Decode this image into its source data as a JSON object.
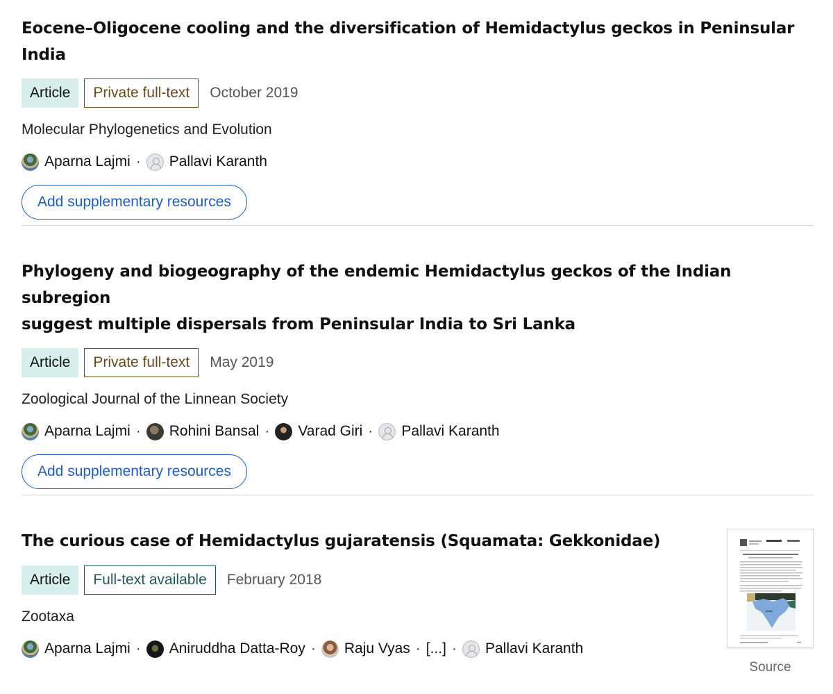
{
  "publications": [
    {
      "title": "Eocene–Oligocene cooling and the diversification of Hemidactylus geckos in Peninsular India",
      "type": "Article",
      "access": "Private full-text",
      "date": "October 2019",
      "journal": "Molecular Phylogenetics and Evolution",
      "authors": [
        "Aparna Lajmi",
        "Pallavi Karanth"
      ],
      "button": "Add supplementary resources"
    },
    {
      "title_line1": "Phylogeny and biogeography of the endemic Hemidactylus geckos of the Indian subregion",
      "title_line2": "suggest multiple dispersals from Peninsular India to Sri Lanka",
      "type": "Article",
      "access": "Private full-text",
      "date": "May 2019",
      "journal": "Zoological Journal of the Linnean Society",
      "authors": [
        "Aparna Lajmi",
        "Rohini Bansal",
        "Varad Giri",
        "Pallavi Karanth"
      ],
      "button": "Add supplementary resources"
    },
    {
      "title": "The curious case of Hemidactylus gujaratensis (Squamata: Gekkonidae)",
      "type": "Article",
      "access": "Full-text available",
      "date": "February 2018",
      "journal": "Zootaxa",
      "authors": [
        "Aparna Lajmi",
        "Aniruddha Datta-Roy",
        "Raju Vyas",
        "[...]",
        "Pallavi Karanth"
      ],
      "thumbnail_caption": "Source"
    }
  ],
  "separator": "·"
}
